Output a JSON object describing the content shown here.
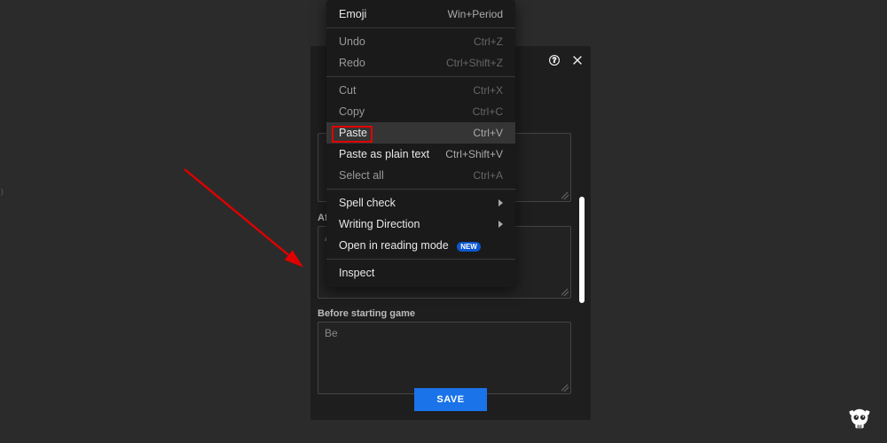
{
  "dialog": {
    "help_tooltip": "Help",
    "close_tooltip": "Close",
    "labels": {
      "after": "After loading courses",
      "before": "Before starting game"
    },
    "textareas": {
      "ta1_placeholder": "",
      "ta2_value": "Af",
      "ta3_value": "Be"
    },
    "save_label": "SAVE"
  },
  "context_menu": {
    "items": [
      {
        "label": "Emoji",
        "shortcut": "Win+Period",
        "state": "normal"
      },
      {
        "sep": true
      },
      {
        "label": "Undo",
        "shortcut": "Ctrl+Z",
        "state": "dim"
      },
      {
        "label": "Redo",
        "shortcut": "Ctrl+Shift+Z",
        "state": "dim"
      },
      {
        "sep": true
      },
      {
        "label": "Cut",
        "shortcut": "Ctrl+X",
        "state": "dim"
      },
      {
        "label": "Copy",
        "shortcut": "Ctrl+C",
        "state": "dim"
      },
      {
        "label": "Paste",
        "shortcut": "Ctrl+V",
        "state": "hover",
        "highlighted": true
      },
      {
        "label": "Paste as plain text",
        "shortcut": "Ctrl+Shift+V",
        "state": "normal"
      },
      {
        "label": "Select all",
        "shortcut": "Ctrl+A",
        "state": "dim"
      },
      {
        "sep": true
      },
      {
        "label": "Spell check",
        "submenu": true,
        "state": "normal"
      },
      {
        "label": "Writing Direction",
        "submenu": true,
        "state": "normal"
      },
      {
        "label": "Open in reading mode",
        "badge": "NEW",
        "state": "normal"
      },
      {
        "sep": true
      },
      {
        "label": "Inspect",
        "state": "normal"
      }
    ]
  },
  "annotation": {
    "arrow_color": "#e00000",
    "highlight_color": "#e00000"
  }
}
